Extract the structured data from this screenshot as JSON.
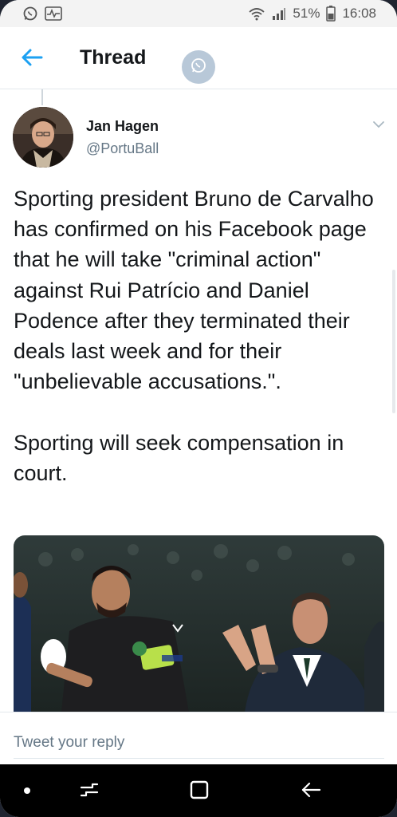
{
  "status_bar": {
    "battery": "51%",
    "time": "16:08",
    "left_icons": [
      "whatsapp-icon",
      "pulse-icon"
    ],
    "right_icons": [
      "wifi-icon",
      "signal-icon",
      "battery-icon"
    ]
  },
  "header": {
    "title": "Thread",
    "back_icon": "arrow-left-icon",
    "floating_icon": "whatsapp-icon"
  },
  "tweet": {
    "author_name": "Jan Hagen",
    "author_handle": "@PortuBall",
    "text": "Sporting president Bruno de Carvalho has confirmed on his Facebook page that he will take \"criminal action\" against Rui Patrício and Daniel Podence after they terminated their deals last week and for their \"unbelievable accusations.\".\n\nSporting will seek compensation in court.",
    "options_icon": "chevron-down-icon"
  },
  "reply": {
    "placeholder": "Tweet your reply"
  },
  "nav": {
    "icons": [
      "dot-icon",
      "recent-apps-icon",
      "home-square-icon",
      "back-arrow-icon"
    ]
  },
  "colors": {
    "accent": "#1da1f2",
    "text": "#14171a",
    "secondary": "#657786",
    "status_bar_bg": "#f3f3f3",
    "nav_bg": "#000000"
  }
}
